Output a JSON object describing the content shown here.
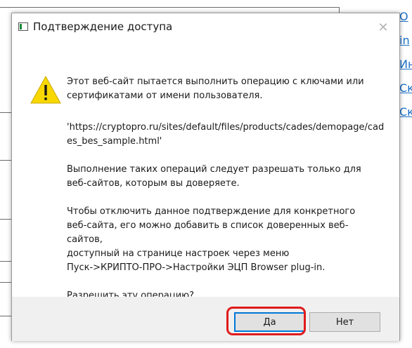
{
  "background": {
    "links": [
      "О",
      "in",
      "Ин",
      "Ск",
      "Ск"
    ]
  },
  "dialog": {
    "title": "Подтверждение доступа",
    "close_glyph": "✕",
    "message": {
      "intro": "Этот веб-сайт пытается выполнить операцию с ключами или\nсертификатами от имени пользователя.",
      "url": "'https://cryptopro.ru/sites/default/files/products/cades/demopage/cad\nes_bes_sample.html'",
      "advice": "Выполнение таких операций следует разрешать только для\nвеб-сайтов, которым вы доверяете.",
      "disable_hint": "Чтобы отключить данное подтверждение для конкретного\nвеб-сайта, его можно добавить в список доверенных веб-сайтов,\nдоступный на странице настроек через меню\nПуск->КРИПТО-ПРО->Настройки ЭЦП Browser plug-in.",
      "question": "Разрешить эту операцию?"
    },
    "buttons": {
      "yes": "Да",
      "no": "Нет"
    },
    "icons": {
      "app": "window-app-icon",
      "warning": "warning-icon",
      "close": "close-icon"
    }
  },
  "colors": {
    "highlight": "#e01b1b",
    "link": "#1a6fc6",
    "warning_fill": "#f8d800",
    "accent": "#0078d7"
  }
}
